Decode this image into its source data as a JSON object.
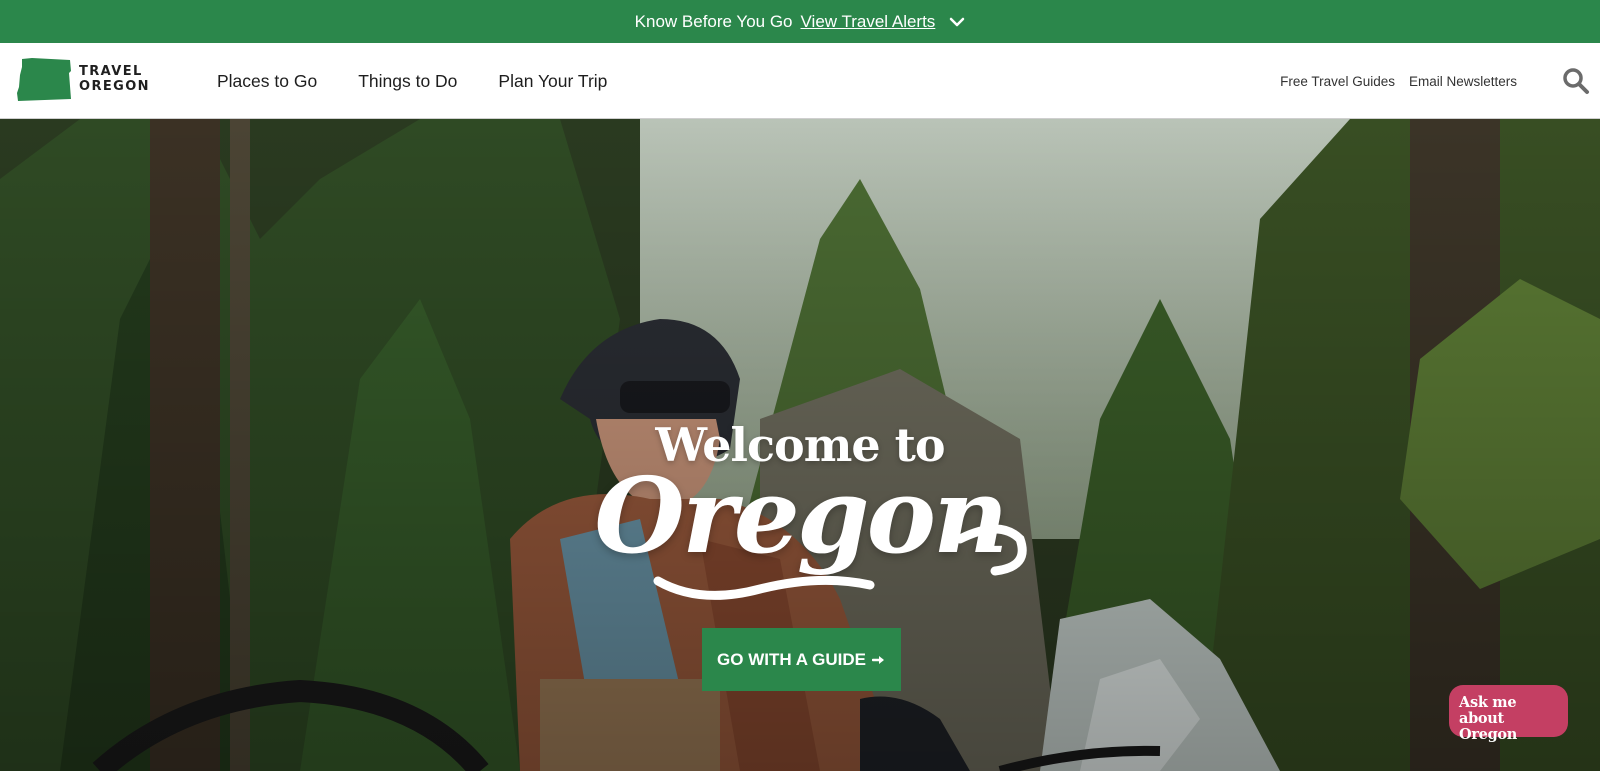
{
  "alert_bar": {
    "text": "Know Before You Go",
    "link": "View Travel Alerts",
    "icon": "chevron-down-icon"
  },
  "header": {
    "logo": {
      "line1": "TRAVEL",
      "line2": "OREGON",
      "icon": "oregon-state-icon"
    },
    "main_nav": [
      "Places to Go",
      "Things to Do",
      "Plan Your Trip"
    ],
    "util_nav": [
      "Free Travel Guides",
      "Email Newsletters"
    ],
    "search_icon": "search-icon"
  },
  "hero": {
    "welcome": "Welcome to",
    "title": "Oregon",
    "cta": "GO WITH A GUIDE",
    "cta_icon": "arrow-right-icon"
  },
  "chat": {
    "line1": "Ask me",
    "line2": "about Oregon"
  },
  "colors": {
    "brand_green": "#2b874b",
    "chat_pink": "#c43f63",
    "header_bg": "#ffffff"
  }
}
